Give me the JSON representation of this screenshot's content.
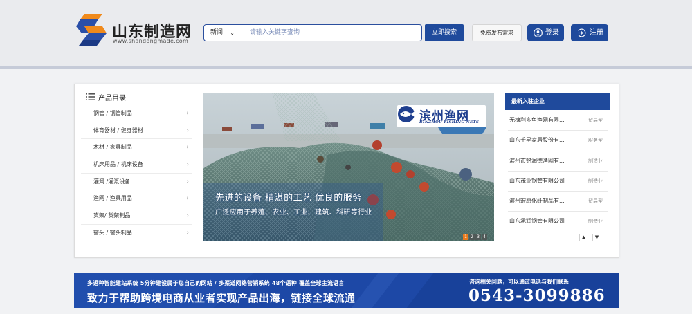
{
  "site": {
    "name": "山东制造网",
    "url": "www.shandongmade.com"
  },
  "search": {
    "category": "新闻",
    "placeholder": "请输入关键字查询",
    "button": "立即搜索"
  },
  "header_actions": {
    "publish": "免费发布需求",
    "login": "登录",
    "register": "注册"
  },
  "categories": {
    "title": "产品目录",
    "items": [
      "钢管 / 钢管制品",
      "体育器材 / 健身器材",
      "木材 / 家具制品",
      "机床用品 / 机床设备",
      "灌溉 /灌溉设备",
      "渔网 / 渔具用品",
      "货架/ 货架制品",
      "窖头 / 窖头制品"
    ]
  },
  "banner": {
    "brand_cn": "滨州渔网",
    "brand_en": "BINZHOU FISHING NETS",
    "slogan": "先进的设备  精湛的工艺  优良的服务",
    "subtitle": "广泛应用于养殖、农业、工业、建筑、科研等行业",
    "slides": [
      "1",
      "2",
      "3",
      "4"
    ],
    "active_slide": 1
  },
  "companies": {
    "title": "最新入驻企业",
    "items": [
      {
        "name": "无棣利多鱼渔网有限...",
        "type": "贸易型"
      },
      {
        "name": "山东千星家居股份有...",
        "type": "服务型"
      },
      {
        "name": "滨州市铭润德渔网有...",
        "type": "制造业"
      },
      {
        "name": "山东茂业钢管有限公司",
        "type": "制造业"
      },
      {
        "name": "滨州宏愿化纤制品有...",
        "type": "贸易型"
      },
      {
        "name": "山东承润钢管有限公司",
        "type": "制造业"
      }
    ],
    "nav_up": "▲",
    "nav_down": "▼"
  },
  "footer_banner": {
    "features": "多语种智能建站系统    5分钟建设属于您自己的网站  /  多渠道网络营销系统    48个语种    覆盖全球主流语言",
    "headline": "致力于帮助跨境电商从业者实现产品出海，链接全球流通",
    "contact_label": "咨询相关问题，可以通过电话与我们联系",
    "phone": "0543-3099886"
  },
  "colors": {
    "primary": "#1f4a9c",
    "header_bg": "#eaebee",
    "accent_orange": "#e87a1d"
  }
}
